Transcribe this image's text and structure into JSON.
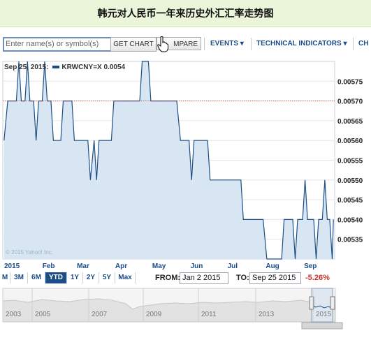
{
  "banner": {
    "title": "韩元对人民币一年来历史外汇汇率走势图"
  },
  "toolbar": {
    "search_placeholder": "Enter name(s) or symbol(s)",
    "get_chart_label": "GET CHART",
    "compare_label": "COMPARE",
    "compare_visible": "MPARE",
    "events_label": "EVENTS ▾",
    "technical_label": "TECHNICAL INDICATORS ▾",
    "cut_label": "CH"
  },
  "legend": {
    "date": "Sep 25, 2015:",
    "series": "KRWCNY=X 0.0054"
  },
  "copyright": "© 2015 Yahoo! Inc.",
  "range": {
    "buttons": [
      "M",
      "3M",
      "6M",
      "YTD",
      "1Y",
      "2Y",
      "5Y",
      "Max"
    ],
    "active": "YTD",
    "from_label": "FROM:",
    "from_value": "Jan 2 2015",
    "to_label": "TO:",
    "to_value": "Sep 25 2015",
    "change": "-5.26%"
  },
  "navigator": {
    "years": [
      "2003",
      "2005",
      "2007",
      "2009",
      "2011",
      "2013",
      "2015"
    ]
  },
  "chart_data": {
    "type": "area",
    "series_name": "KRWCNY=X",
    "x_ticks": [
      "2015",
      "Feb",
      "Mar",
      "Apr",
      "May",
      "Jun",
      "Jul",
      "Aug",
      "Sep"
    ],
    "y_ticks": [
      0.00535,
      0.0054,
      0.00545,
      0.0055,
      0.00555,
      0.0056,
      0.00565,
      0.0057,
      0.00575
    ],
    "ylim": [
      0.0053,
      0.0058
    ],
    "xlim": [
      "2015-01-01",
      "2015-09-27"
    ],
    "reference_line": 0.0057,
    "points": [
      [
        "2015-01-02",
        0.0056
      ],
      [
        "2015-01-05",
        0.0057
      ],
      [
        "2015-01-12",
        0.0057
      ],
      [
        "2015-01-14",
        0.0058
      ],
      [
        "2015-01-16",
        0.0057
      ],
      [
        "2015-01-19",
        0.0057
      ],
      [
        "2015-01-21",
        0.0058
      ],
      [
        "2015-01-23",
        0.0057
      ],
      [
        "2015-01-26",
        0.0057
      ],
      [
        "2015-01-28",
        0.0056
      ],
      [
        "2015-01-30",
        0.0057
      ],
      [
        "2015-02-02",
        0.0057
      ],
      [
        "2015-02-04",
        0.0058
      ],
      [
        "2015-02-06",
        0.0057
      ],
      [
        "2015-02-09",
        0.0057
      ],
      [
        "2015-02-11",
        0.0056
      ],
      [
        "2015-02-17",
        0.0056
      ],
      [
        "2015-02-19",
        0.0057
      ],
      [
        "2015-02-26",
        0.0057
      ],
      [
        "2015-02-28",
        0.0056
      ],
      [
        "2015-03-11",
        0.0056
      ],
      [
        "2015-03-13",
        0.0055
      ],
      [
        "2015-03-16",
        0.0056
      ],
      [
        "2015-03-18",
        0.0055
      ],
      [
        "2015-03-20",
        0.0056
      ],
      [
        "2015-03-30",
        0.0056
      ],
      [
        "2015-04-01",
        0.0057
      ],
      [
        "2015-04-22",
        0.0057
      ],
      [
        "2015-04-24",
        0.0058
      ],
      [
        "2015-04-29",
        0.0058
      ],
      [
        "2015-05-01",
        0.0057
      ],
      [
        "2015-05-22",
        0.0057
      ],
      [
        "2015-05-25",
        0.0056
      ],
      [
        "2015-06-01",
        0.0056
      ],
      [
        "2015-06-03",
        0.0055
      ],
      [
        "2015-06-05",
        0.0056
      ],
      [
        "2015-06-16",
        0.0056
      ],
      [
        "2015-06-18",
        0.0055
      ],
      [
        "2015-06-30",
        0.0055
      ],
      [
        "2015-07-02",
        0.0055
      ],
      [
        "2015-07-13",
        0.0055
      ],
      [
        "2015-07-15",
        0.0054
      ],
      [
        "2015-07-31",
        0.0054
      ],
      [
        "2015-08-03",
        0.0053
      ],
      [
        "2015-08-15",
        0.0053
      ],
      [
        "2015-08-17",
        0.0054
      ],
      [
        "2015-08-24",
        0.0054
      ],
      [
        "2015-08-26",
        0.0053
      ],
      [
        "2015-08-28",
        0.0054
      ],
      [
        "2015-09-01",
        0.0054
      ],
      [
        "2015-09-03",
        0.0055
      ],
      [
        "2015-09-05",
        0.0054
      ],
      [
        "2015-09-10",
        0.0054
      ],
      [
        "2015-09-12",
        0.0053
      ],
      [
        "2015-09-14",
        0.0054
      ],
      [
        "2015-09-17",
        0.0054
      ],
      [
        "2015-09-19",
        0.0055
      ],
      [
        "2015-09-21",
        0.0054
      ],
      [
        "2015-09-23",
        0.0054
      ],
      [
        "2015-09-25",
        0.0053
      ],
      [
        "2015-09-26",
        0.0054
      ]
    ]
  },
  "colors": {
    "line": "#1d4f86",
    "fill": "#d7e6f2",
    "reference": "#c0392b",
    "active_range": "#1d4f86",
    "negative": "#d4302a",
    "banner_bg": "#ebf5da"
  }
}
